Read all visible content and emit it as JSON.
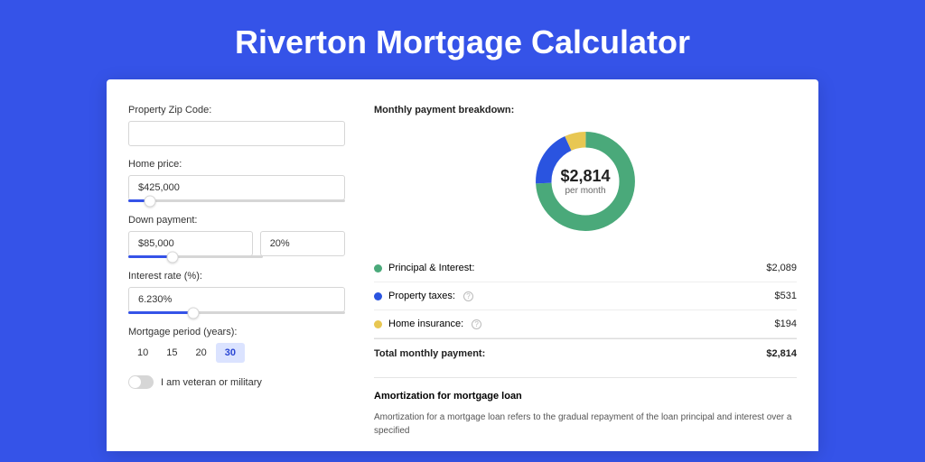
{
  "title": "Riverton Mortgage Calculator",
  "form": {
    "zip_label": "Property Zip Code:",
    "zip_value": "",
    "home_price_label": "Home price:",
    "home_price_value": "$425,000",
    "down_payment_label": "Down payment:",
    "down_payment_value": "$85,000",
    "down_payment_pct": "20%",
    "interest_label": "Interest rate (%):",
    "interest_value": "6.230%",
    "period_label": "Mortgage period (years):",
    "periods": [
      "10",
      "15",
      "20",
      "30"
    ],
    "period_active": "30",
    "veteran_label": "I am veteran or military"
  },
  "breakdown": {
    "title": "Monthly payment breakdown:",
    "center_amount": "$2,814",
    "center_sub": "per month",
    "items": [
      {
        "label": "Principal & Interest:",
        "value": "$2,089",
        "color": "green",
        "info": false
      },
      {
        "label": "Property taxes:",
        "value": "$531",
        "color": "blue",
        "info": true
      },
      {
        "label": "Home insurance:",
        "value": "$194",
        "color": "yellow",
        "info": true
      }
    ],
    "total_label": "Total monthly payment:",
    "total_value": "$2,814"
  },
  "amortization": {
    "title": "Amortization for mortgage loan",
    "text": "Amortization for a mortgage loan refers to the gradual repayment of the loan principal and interest over a specified"
  },
  "chart_data": {
    "type": "pie",
    "title": "Monthly payment breakdown",
    "series": [
      {
        "name": "Principal & Interest",
        "value": 2089,
        "color": "#4aa97a"
      },
      {
        "name": "Property taxes",
        "value": 531,
        "color": "#2a54e0"
      },
      {
        "name": "Home insurance",
        "value": 194,
        "color": "#e8c752"
      }
    ],
    "total": 2814,
    "unit": "USD per month"
  }
}
